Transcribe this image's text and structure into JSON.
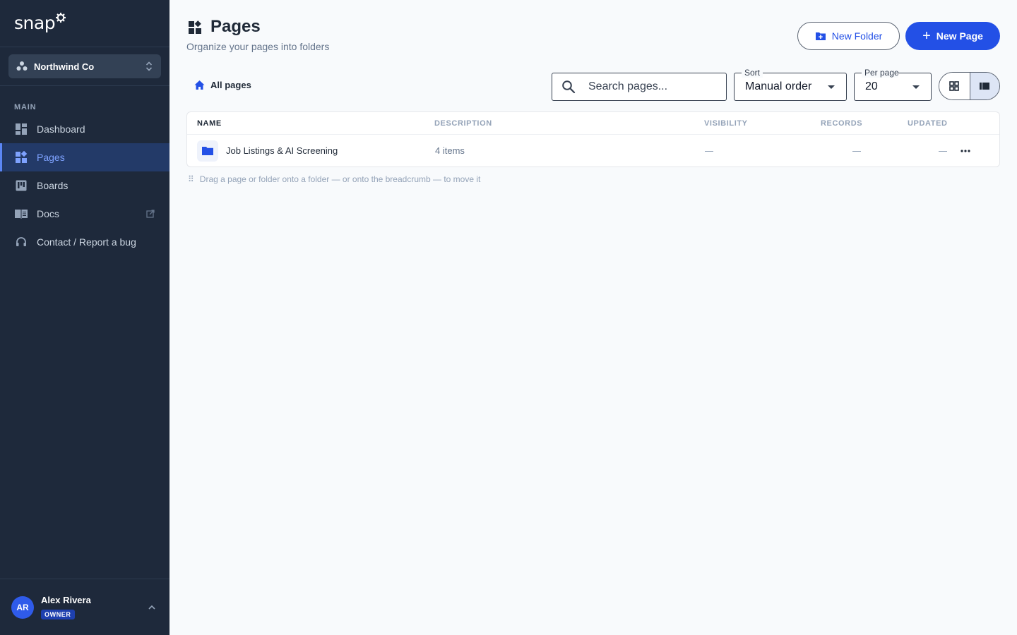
{
  "app": {
    "logo_text": "snap"
  },
  "sidebar": {
    "org": {
      "name": "Northwind Co"
    },
    "section_label": "MAIN",
    "items": [
      {
        "label": "Dashboard",
        "icon": "dashboard-icon",
        "active": false
      },
      {
        "label": "Pages",
        "icon": "pages-icon",
        "active": true
      },
      {
        "label": "Boards",
        "icon": "boards-icon",
        "active": false
      },
      {
        "label": "Docs",
        "icon": "docs-icon",
        "active": false,
        "external": true
      },
      {
        "label": "Contact / Report a bug",
        "icon": "support-icon",
        "active": false
      }
    ],
    "user": {
      "initials": "AR",
      "name": "Alex Rivera",
      "role": "OWNER"
    }
  },
  "header": {
    "title": "Pages",
    "subtitle": "Organize your pages into folders",
    "new_folder_label": "New Folder",
    "new_page_label": "New Page",
    "new_page_prefix": "+"
  },
  "toolbar": {
    "breadcrumb": "All pages",
    "search_placeholder": "Search pages...",
    "sort": {
      "label": "Sort",
      "value": "Manual order"
    },
    "per_page": {
      "label": "Per page",
      "value": "20"
    },
    "view": "list"
  },
  "table": {
    "columns": [
      "NAME",
      "DESCRIPTION",
      "VISIBILITY",
      "RECORDS",
      "UPDATED"
    ],
    "rows": [
      {
        "name": "Job Listings & AI Screening",
        "description": "4 items",
        "visibility": "—",
        "records": "—",
        "updated": "—",
        "type": "folder"
      }
    ]
  },
  "hint": "Drag a page or folder onto a folder — or onto the breadcrumb — to move it",
  "colors": {
    "sidebar_bg": "#1e293b",
    "accent": "#2350e6",
    "active_nav_bg": "#233a68",
    "page_bg": "#f8fafc"
  }
}
